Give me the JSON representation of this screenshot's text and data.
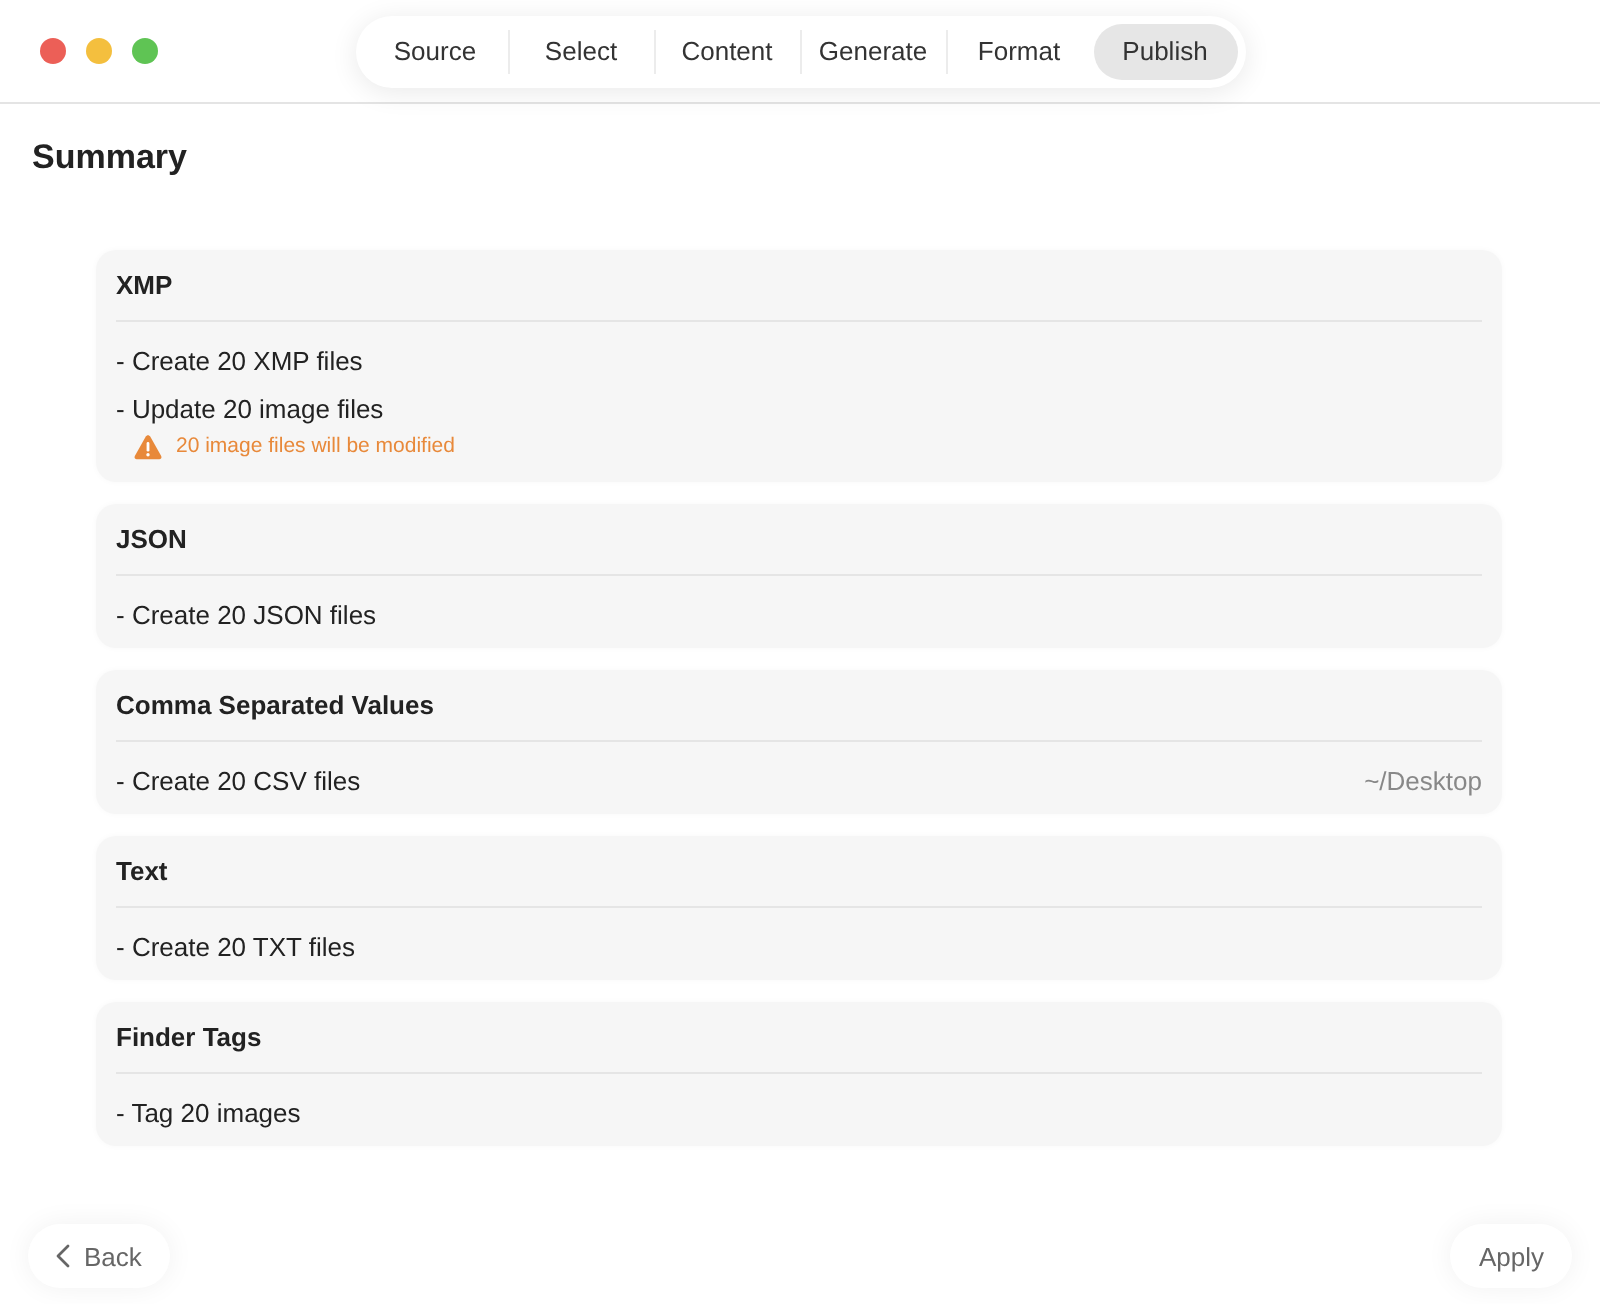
{
  "toolbar": {
    "tabs": [
      {
        "label": "Source",
        "selected": false
      },
      {
        "label": "Select",
        "selected": false
      },
      {
        "label": "Content",
        "selected": false
      },
      {
        "label": "Generate",
        "selected": false
      },
      {
        "label": "Format",
        "selected": false
      },
      {
        "label": "Publish",
        "selected": true
      }
    ]
  },
  "heading": "Summary",
  "sections": [
    {
      "title": "XMP",
      "lines": [
        {
          "text": "- Create 20 XMP files"
        },
        {
          "text": "- Update 20 image files",
          "warning": "20 image files will be modified"
        }
      ]
    },
    {
      "title": "JSON",
      "lines": [
        {
          "text": "- Create 20 JSON files"
        }
      ]
    },
    {
      "title": "Comma Separated Values",
      "lines": [
        {
          "text": "- Create 20 CSV files",
          "location": "~/Desktop"
        }
      ]
    },
    {
      "title": "Text",
      "lines": [
        {
          "text": "- Create 20 TXT files"
        }
      ]
    },
    {
      "title": "Finder Tags",
      "lines": [
        {
          "text": "- Tag 20 images"
        }
      ]
    }
  ],
  "footer": {
    "back": "Back",
    "apply": "Apply"
  }
}
